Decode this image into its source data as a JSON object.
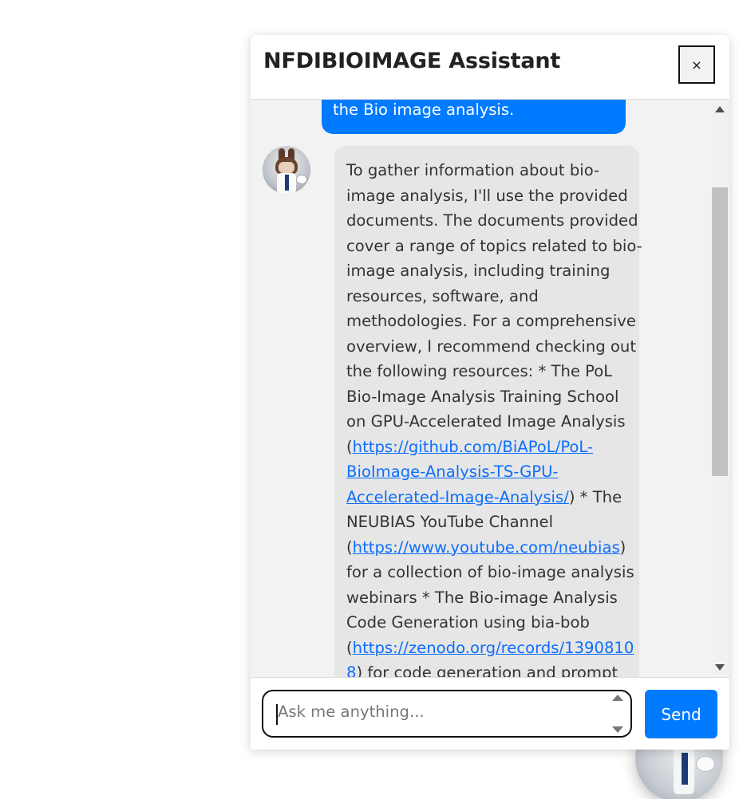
{
  "header": {
    "title": "NFDIBIOIMAGE Assistant",
    "close_label": "×"
  },
  "messages": {
    "user_message": {
      "visible_line": "the Bio image analysis."
    },
    "bot_message": {
      "lines": [
        {
          "text": "To gather information about bio-"
        },
        {
          "text": "image analysis, I'll use the provided"
        },
        {
          "text": "documents. The documents provided"
        },
        {
          "text": "cover a range of topics related to bio-"
        },
        {
          "text": "image analysis, including training"
        },
        {
          "text": "resources, software, and"
        },
        {
          "text": "methodologies. For a comprehensive"
        },
        {
          "text": "overview, I recommend checking out"
        },
        {
          "text": "the following resources: * The PoL"
        },
        {
          "text": "Bio-Image Analysis Training School"
        },
        {
          "text": "on GPU-Accelerated Image Analysis"
        },
        {
          "pre": "(",
          "link": "https://github.com/BiAPoL/PoL-",
          "post": ""
        },
        {
          "pre": "",
          "link": "BioImage-Analysis-TS-GPU-",
          "post": ""
        },
        {
          "pre": "",
          "link": "Accelerated-Image-Analysis/",
          "post": ") * The"
        },
        {
          "text": "NEUBIAS YouTube Channel"
        },
        {
          "pre": "(",
          "link": "https://www.youtube.com/neubias",
          "post": ")"
        },
        {
          "text": "for a collection of bio-image analysis"
        },
        {
          "text": "webinars * The Bio-image Analysis"
        },
        {
          "text": "Code Generation using bia-bob"
        },
        {
          "pre": "(",
          "link": "https://zenodo.org/records/1390810",
          "post": ""
        },
        {
          "pre": "",
          "link": "8",
          "post": ") for code generation and prompt"
        }
      ]
    }
  },
  "input": {
    "placeholder": "Ask me anything...",
    "value": ""
  },
  "send_label": "Send",
  "colors": {
    "accent": "#007bff",
    "bot_bubble": "#e6e6e6",
    "link": "#0d6efd"
  }
}
